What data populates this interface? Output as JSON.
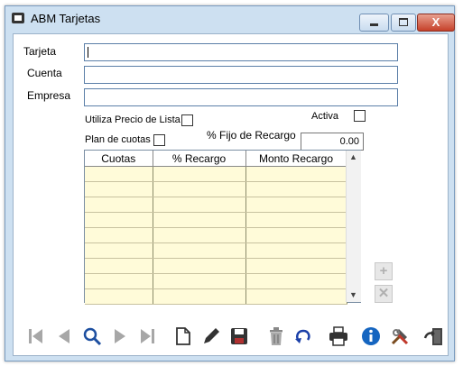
{
  "window": {
    "title": "ABM Tarjetas"
  },
  "titlebar_buttons": {
    "close_glyph": "X"
  },
  "form": {
    "tarjeta_label": "Tarjeta",
    "cuenta_label": "Cuenta",
    "empresa_label": "Empresa",
    "tarjeta_value": "",
    "cuenta_value": "",
    "empresa_value": "",
    "utiliza_precio_label": "Utiliza Precio de Lista",
    "activa_label": "Activa",
    "plan_cuotas_label": "Plan de cuotas",
    "fijo_recargo_label": "% Fijo de Recargo",
    "fijo_recargo_value": "0.00"
  },
  "grid": {
    "columns": [
      "Cuotas",
      "% Recargo",
      "Monto Recargo"
    ],
    "row_count_visible": 9
  },
  "side_buttons": {
    "add_glyph": "+",
    "delete_glyph": "✕"
  },
  "toolbar": {
    "icons": [
      "first-icon",
      "prev-icon",
      "search-icon",
      "next-icon",
      "last-icon",
      "new-doc-icon",
      "edit-pencil-icon",
      "save-disk-icon",
      "trash-icon",
      "undo-icon",
      "print-icon",
      "info-icon",
      "tools-icon",
      "exit-door-icon"
    ]
  },
  "colors": {
    "grid_row_bg": "#fffbd9",
    "window_frame": "#cde0f1",
    "info_blue": "#1565c0",
    "undo_blue": "#1a3fa8"
  }
}
